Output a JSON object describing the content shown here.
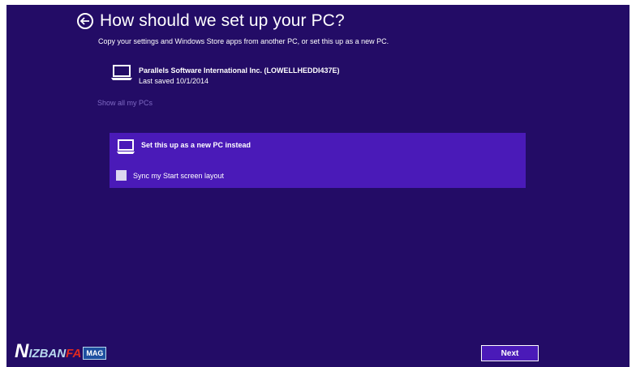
{
  "page": {
    "title": "How should we set up your PC?",
    "subtitle": "Copy your settings and Windows Store apps from another PC, or set this up as a new PC."
  },
  "existing_pc": {
    "name": "Parallels Software International Inc. (LOWELLHEDDI437E)",
    "last_saved": "Last saved 10/1/2014",
    "icon": "laptop-icon"
  },
  "show_all_label": "Show all my PCs",
  "new_pc": {
    "label": "Set this up as a new PC instead",
    "icon": "laptop-icon"
  },
  "sync": {
    "label": "Sync my Start screen layout",
    "checked": false
  },
  "next_label": "Next",
  "back_icon": "back-arrow-icon",
  "watermark": {
    "n": "N",
    "izban": "IZBAN",
    "fa": "FA",
    "mag": "MAG"
  },
  "colors": {
    "background": "#230c66",
    "accent": "#4a1ab8",
    "link": "#7f6ac4"
  }
}
